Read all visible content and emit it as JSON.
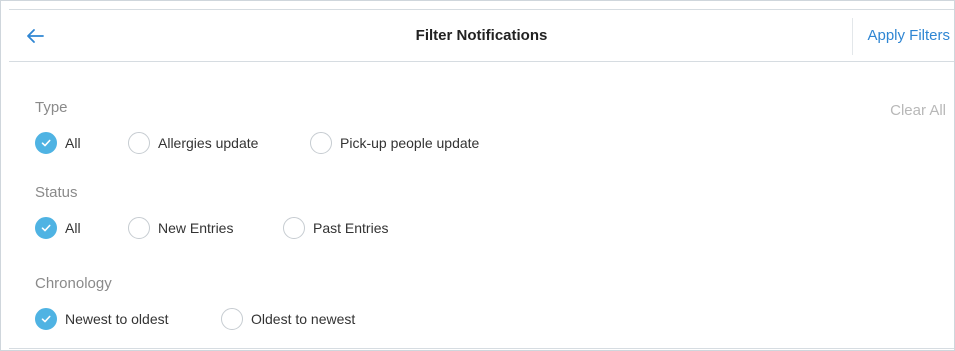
{
  "header": {
    "title": "Filter Notifications",
    "apply_label": "Apply Filters",
    "back_icon": "arrow-left-icon"
  },
  "clear_label": "Clear All",
  "colors": {
    "accent": "#2f86d3",
    "checked": "#4fb3e3"
  },
  "sections": {
    "type": {
      "label": "Type",
      "options": [
        {
          "label": "All",
          "checked": true
        },
        {
          "label": "Allergies update",
          "checked": false
        },
        {
          "label": "Pick-up people update",
          "checked": false
        }
      ]
    },
    "status": {
      "label": "Status",
      "options": [
        {
          "label": "All",
          "checked": true
        },
        {
          "label": "New Entries",
          "checked": false
        },
        {
          "label": "Past Entries",
          "checked": false
        }
      ]
    },
    "chronology": {
      "label": "Chronology",
      "options": [
        {
          "label": "Newest to oldest",
          "checked": true
        },
        {
          "label": "Oldest to newest",
          "checked": false
        }
      ]
    }
  }
}
